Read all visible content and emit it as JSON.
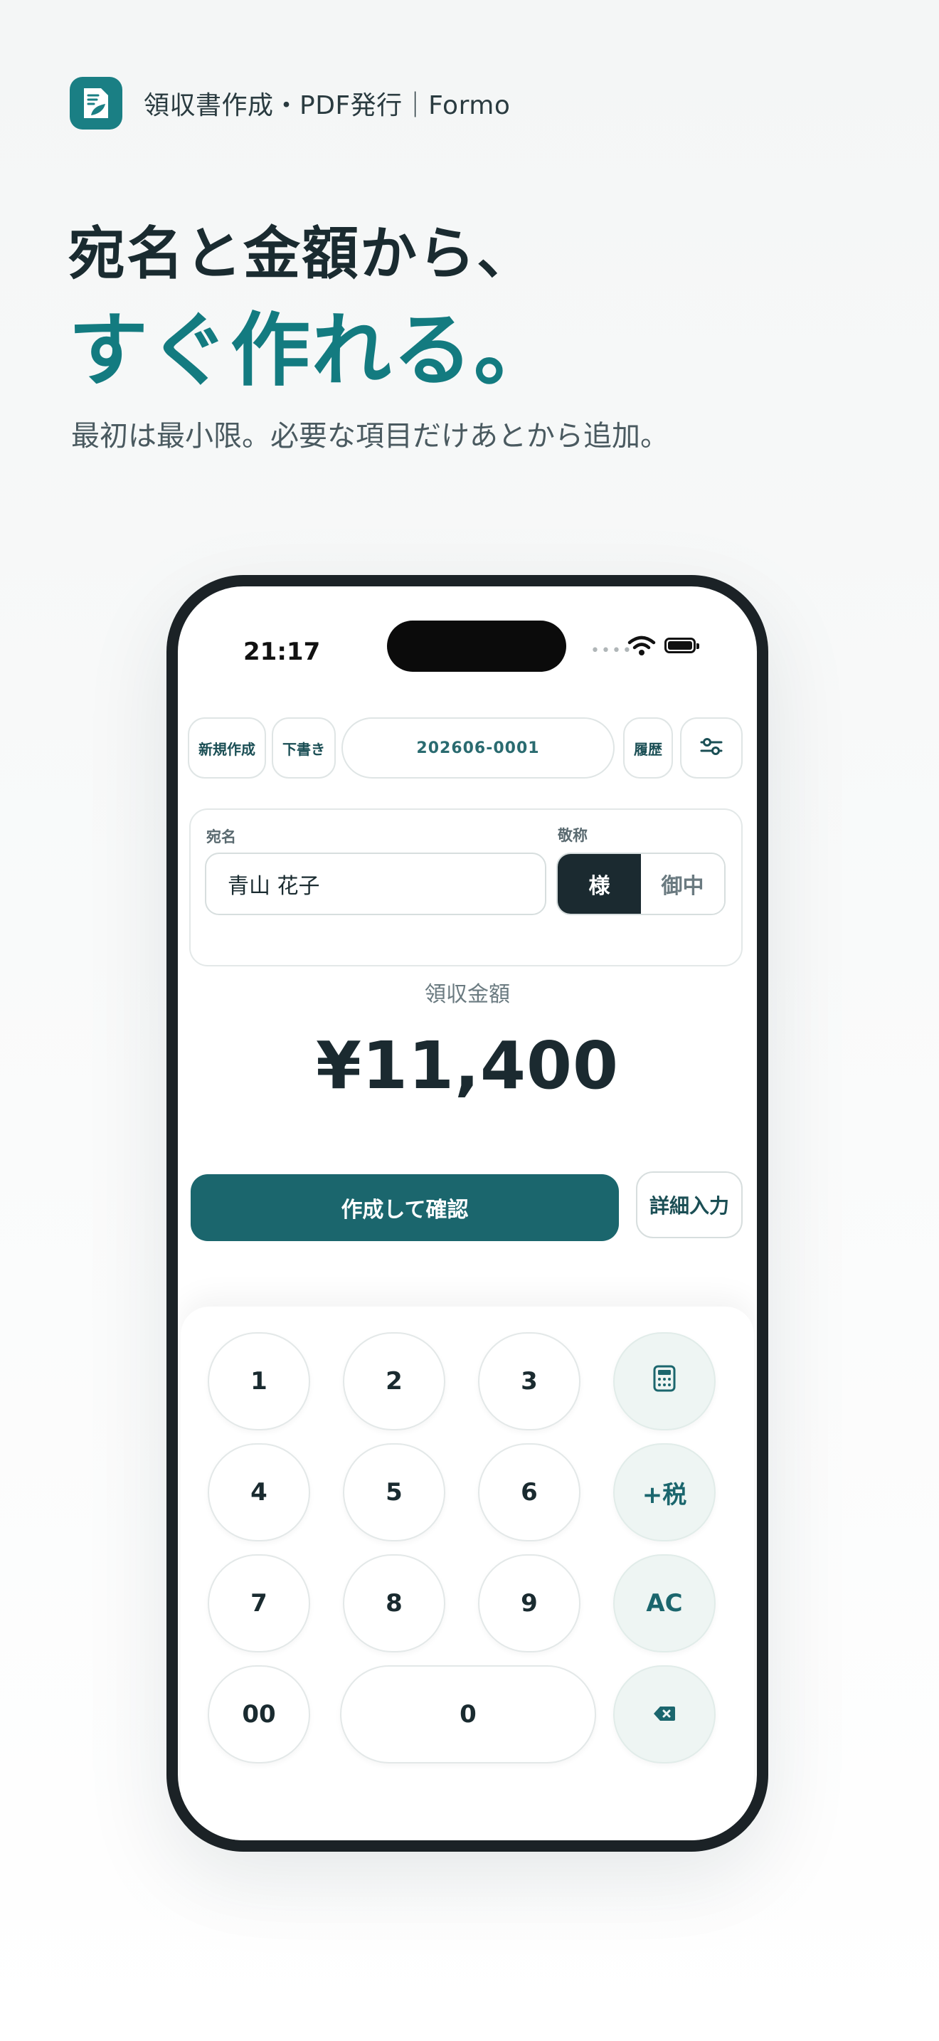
{
  "brand": {
    "name": "領収書作成・PDF発行｜Formo",
    "logo_icon": "receipt-leaf-icon",
    "color": "#1a7f84"
  },
  "hero": {
    "line1": "宛名と金額から、",
    "line2": "すぐ作れる。",
    "subtitle": "最初は最小限。必要な項目だけあとから追加。"
  },
  "status": {
    "time": "21:17",
    "dots": "••••"
  },
  "toolbar": {
    "new": "新規作成",
    "draft": "下書き",
    "number": "202606-0001",
    "history": "履歴",
    "settings_icon": "sliders-icon"
  },
  "form": {
    "recipient_label": "宛名",
    "recipient_value": "青山 花子",
    "honorific_label": "敬称",
    "honorific_options": [
      "様",
      "御中"
    ],
    "honorific_selected": "様"
  },
  "amount": {
    "label": "領収金額",
    "value": "¥11,400"
  },
  "actions": {
    "create": "作成して確認",
    "detail": "詳細入力"
  },
  "keypad": {
    "digits": [
      "1",
      "2",
      "3",
      "4",
      "5",
      "6",
      "7",
      "8",
      "9",
      "00",
      "0"
    ],
    "calc_icon": "calculator-icon",
    "tax": "+税",
    "clear": "AC",
    "backspace_icon": "backspace-icon"
  },
  "colors": {
    "accent": "#1b666d",
    "headline_accent": "#137b80",
    "dark": "#1b2a30"
  }
}
